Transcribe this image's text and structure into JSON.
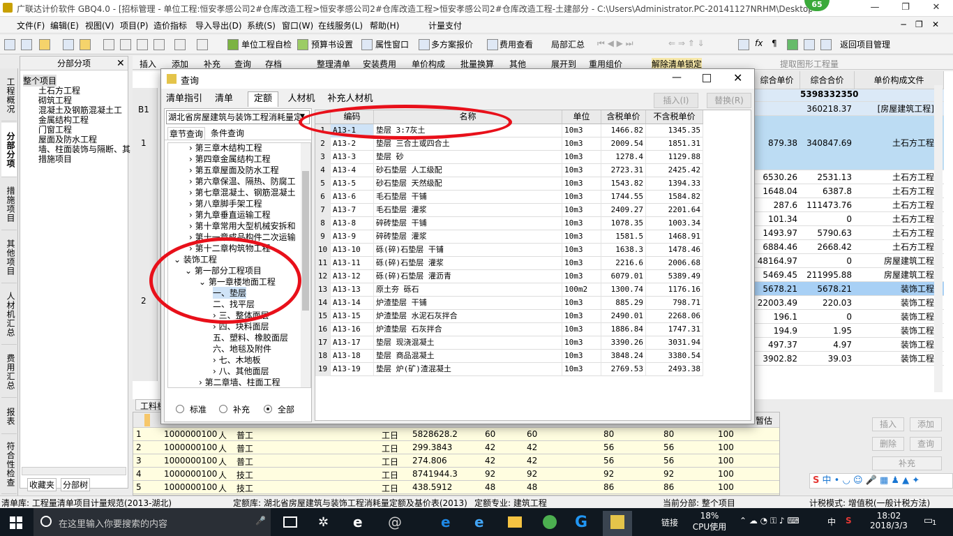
{
  "window": {
    "title": "广联达计价软件 GBQ4.0 - [招标管理 - 单位工程:恒安孝感公司2#仓库改造工程>恒安孝感公司2#仓库改造工程>恒安孝感公司2#仓库改造工程-土建部分 - C:\\Users\\Administrator.PC-20141127NRHM\\Desktop\\恒安孝感公...",
    "badge": "65",
    "minimize": "—",
    "restore": "❐",
    "close": "✕"
  },
  "menu": [
    "文件(F)",
    "编辑(E)",
    "视图(V)",
    "项目(P)",
    "造价指标",
    "导入导出(D)",
    "系统(S)",
    "窗口(W)",
    "在线服务(L)",
    "帮助(H)",
    "计量支付"
  ],
  "menu_right": [
    "−",
    "❐",
    "✕"
  ],
  "toolbar": [
    "单位工程自检",
    "预算书设置",
    "属性窗口",
    "多方案报价",
    "费用查看",
    "局部汇总",
    "返回项目管理"
  ],
  "toolbar2": [
    "插入",
    "添加",
    "补充",
    "查询",
    "存档",
    "整理清单",
    "安装费用",
    "单价构成",
    "批量换算",
    "其他",
    "展开到",
    "重用组价",
    "解除清单锁定",
    "提取图形工程量"
  ],
  "leftnav": [
    "工程概况",
    "分部分项",
    "措施项目",
    "其他项目",
    "人材机汇总",
    "费用汇总",
    "报表",
    "符合性检查"
  ],
  "tree": {
    "header": "分部分项",
    "root": "整个项目",
    "items": [
      "土石方工程",
      "砌筑工程",
      "混凝土及钢筋混凝土工",
      "金属结构工程",
      "门窗工程",
      "屋面及防水工程",
      "墙、柱面装饰与隔断、其",
      "措施项目"
    ],
    "bottom_tabs": [
      "收藏夹",
      "分部树"
    ]
  },
  "main": {
    "row_labels": [
      "B1",
      "1",
      "2"
    ],
    "headers": [
      "综合单价",
      "综合合价",
      "单价构成文件"
    ],
    "summary_total": "5398332350",
    "rows": [
      [
        "",
        "360218.37",
        "[房屋建筑工程]"
      ],
      [
        "879.38",
        "340847.69",
        "土石方工程"
      ],
      [
        "6530.26",
        "2531.13",
        "土石方工程"
      ],
      [
        "1648.04",
        "6387.8",
        "土石方工程"
      ],
      [
        "287.6",
        "111473.76",
        "土石方工程"
      ],
      [
        "101.34",
        "0",
        "土石方工程"
      ],
      [
        "1493.97",
        "5790.63",
        "土石方工程"
      ],
      [
        "6884.46",
        "2668.42",
        "土石方工程"
      ],
      [
        "48164.97",
        "0",
        "房屋建筑工程"
      ],
      [
        "5469.45",
        "211995.88",
        "房屋建筑工程"
      ],
      [
        "5678.21",
        "5678.21",
        "装饰工程"
      ],
      [
        "22003.49",
        "220.03",
        "装饰工程"
      ],
      [
        "196.1",
        "0",
        "装饰工程"
      ],
      [
        "194.9",
        "1.95",
        "装饰工程"
      ],
      [
        "497.37",
        "4.97",
        "装饰工程"
      ],
      [
        "3902.82",
        "39.03",
        "装饰工程"
      ]
    ]
  },
  "lower": {
    "tab": "工料机",
    "right_label": "暂估",
    "rows": [
      [
        "1",
        "1000000100",
        "人",
        "普工",
        "工日",
        "5828628.2",
        "60",
        "60",
        "80",
        "80",
        "100"
      ],
      [
        "2",
        "1000000100",
        "人",
        "普工",
        "工日",
        "299.3843",
        "42",
        "42",
        "56",
        "56",
        "100"
      ],
      [
        "3",
        "1000000100",
        "人",
        "普工",
        "工日",
        "274.806",
        "42",
        "42",
        "56",
        "56",
        "100"
      ],
      [
        "4",
        "1000000100",
        "人",
        "技工",
        "工日",
        "8741944.3",
        "92",
        "92",
        "92",
        "92",
        "100"
      ],
      [
        "5",
        "1000000100",
        "人",
        "技工",
        "工日",
        "438.5912",
        "48",
        "48",
        "86",
        "86",
        "100"
      ]
    ],
    "buttons": [
      "插入",
      "添加",
      "删除",
      "查询",
      "补充"
    ]
  },
  "dialog": {
    "title": "查询",
    "tabs": [
      "清单指引",
      "清单",
      "定额",
      "人材机",
      "补充人材机"
    ],
    "insert_label": "插入(I)",
    "replace_label": "替换(R)",
    "library": "湖北省房屋建筑与装饰工程消耗量定",
    "subtabs": [
      "章节查询",
      "条件查询"
    ],
    "tree": [
      "第三章木结构工程",
      "第四章金属结构工程",
      "第五章屋面及防水工程",
      "第六章保温、隔热、防腐工",
      "第七章混凝土、钢筋混凝土",
      "第八章脚手架工程",
      "第九章垂直运输工程",
      "第十章常用大型机械安拆和",
      "第十一章成品构件二次运输",
      "第十二章构筑物工程",
      "装饰工程",
      "第一部分工程项目",
      "第一章楼地面工程",
      "一、垫层",
      "二、找平层",
      "三、整体面层",
      "四、块料面层",
      "五、塑料、橡胶面层",
      "六、地毯及附件",
      "七、木地板",
      "八、其他面层",
      "第二章墙、柱面工程"
    ],
    "radios": [
      "标准",
      "补充",
      "全部"
    ],
    "grid_headers": [
      "编码",
      "名称",
      "单位",
      "含税单价",
      "不含税单价"
    ],
    "rows": [
      [
        "1",
        "A13-1",
        "垫层 3:7灰土",
        "10m3",
        "1466.82",
        "1345.35"
      ],
      [
        "2",
        "A13-2",
        "垫层 三合土或四合土",
        "10m3",
        "2009.54",
        "1851.31"
      ],
      [
        "3",
        "A13-3",
        "垫层 砂",
        "10m3",
        "1278.4",
        "1129.88"
      ],
      [
        "4",
        "A13-4",
        "砂石垫层 人工级配",
        "10m3",
        "2723.31",
        "2425.42"
      ],
      [
        "5",
        "A13-5",
        "砂石垫层 天然级配",
        "10m3",
        "1543.82",
        "1394.33"
      ],
      [
        "6",
        "A13-6",
        "毛石垫层 干铺",
        "10m3",
        "1744.55",
        "1584.82"
      ],
      [
        "7",
        "A13-7",
        "毛石垫层 灌浆",
        "10m3",
        "2409.27",
        "2201.64"
      ],
      [
        "8",
        "A13-8",
        "碎砖垫层 干铺",
        "10m3",
        "1078.35",
        "1003.34"
      ],
      [
        "9",
        "A13-9",
        "碎砖垫层 灌浆",
        "10m3",
        "1581.5",
        "1468.91"
      ],
      [
        "10",
        "A13-10",
        "砾(碎)石垫层 干铺",
        "10m3",
        "1638.3",
        "1478.46"
      ],
      [
        "11",
        "A13-11",
        "砾(碎)石垫层 灌浆",
        "10m3",
        "2216.6",
        "2006.68"
      ],
      [
        "12",
        "A13-12",
        "砾(碎)石垫层 灌沥青",
        "10m3",
        "6079.01",
        "5389.49"
      ],
      [
        "13",
        "A13-13",
        "原土夯 砾石",
        "100m2",
        "1300.74",
        "1176.16"
      ],
      [
        "14",
        "A13-14",
        "炉渣垫层 干铺",
        "10m3",
        "885.29",
        "798.71"
      ],
      [
        "15",
        "A13-15",
        "炉渣垫层 水泥石灰拌合",
        "10m3",
        "2490.01",
        "2268.06"
      ],
      [
        "16",
        "A13-16",
        "炉渣垫层 石灰拌合",
        "10m3",
        "1886.84",
        "1747.31"
      ],
      [
        "17",
        "A13-17",
        "垫层 现浇混凝土",
        "10m3",
        "3390.26",
        "3031.94"
      ],
      [
        "18",
        "A13-18",
        "垫层 商品混凝土",
        "10m3",
        "3848.24",
        "3380.54"
      ],
      [
        "19",
        "A13-19",
        "垫层 炉(矿)渣混凝土",
        "10m3",
        "2769.53",
        "2493.38"
      ]
    ]
  },
  "statusbar": {
    "list_lib": "清单库: 工程量清单项目计量规范(2013-湖北)",
    "quota_lib": "定额库: 湖北省房屋建筑与装饰工程消耗量定额及基价表(2013)",
    "specialty": "定额专业: 建筑工程",
    "current": "当前分部: 整个项目",
    "tax_mode": "计税模式: 增值税(一般计税方法)"
  },
  "taskbar": {
    "search_placeholder": "在这里输入你要搜索的内容",
    "link": "链接",
    "cpu_percent": "18%",
    "cpu_label": "CPU使用",
    "lang": "中",
    "time": "18:02",
    "date": "2018/3/3",
    "notify_count": "1"
  },
  "ime": "中"
}
